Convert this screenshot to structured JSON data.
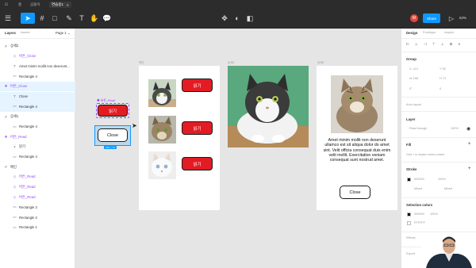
{
  "os_tabs": [
    {
      "label": "홈",
      "active": false
    },
    {
      "label": "곰돌이",
      "active": false
    },
    {
      "label": "연습용1",
      "active": true
    }
  ],
  "toolbar": {
    "share_label": "Share",
    "zoom": "63%",
    "user_initial": "M"
  },
  "layers_panel": {
    "tab_layers": "Layers",
    "tab_assets": "Assets",
    "page": "Page 1",
    "rows": [
      {
        "label": "상세2",
        "indent": 0,
        "kind": "frame"
      },
      {
        "label": "버튼_Close",
        "indent": 1,
        "kind": "instance"
      },
      {
        "label": "Amet minim mollit non deserunt...",
        "indent": 1,
        "kind": "text"
      },
      {
        "label": "Rectangle 4",
        "indent": 1,
        "kind": "rect"
      },
      {
        "label": "버튼_Close",
        "indent": 0,
        "kind": "component",
        "selected": true
      },
      {
        "label": "Close",
        "indent": 1,
        "kind": "text",
        "selected": true
      },
      {
        "label": "Rectangle 4",
        "indent": 1,
        "kind": "rect",
        "selected": true
      },
      {
        "label": "상세1",
        "indent": 0,
        "kind": "frame"
      },
      {
        "label": "Rectangle 4",
        "indent": 1,
        "kind": "rect"
      },
      {
        "label": "버튼_Read",
        "indent": 0,
        "kind": "component"
      },
      {
        "label": "읽기",
        "indent": 1,
        "kind": "text"
      },
      {
        "label": "Rectangle 4",
        "indent": 1,
        "kind": "rect"
      },
      {
        "label": "메인",
        "indent": 0,
        "kind": "frame"
      },
      {
        "label": "버튼_Read",
        "indent": 1,
        "kind": "instance"
      },
      {
        "label": "버튼_Read",
        "indent": 1,
        "kind": "instance"
      },
      {
        "label": "버튼_Read",
        "indent": 1,
        "kind": "instance"
      },
      {
        "label": "Rectangle 3",
        "indent": 1,
        "kind": "rect"
      },
      {
        "label": "Rectangle 2",
        "indent": 1,
        "kind": "rect"
      },
      {
        "label": "Rectangle 1",
        "indent": 1,
        "kind": "rect"
      }
    ]
  },
  "canvas": {
    "component_read_label": "버튼_Read",
    "read_label": "읽기",
    "close_label": "Close",
    "selection_size": "158 × 73",
    "frame_main_label": "메인",
    "frame_detail1_label": "상세1",
    "frame_detail2_label": "상세2",
    "detail_text": "Amet minim mollit non deserunt ullamco est sit aliqua dolor do amet sint. Velit officia consequat duis enim velit mollit. Exercitation veniam consequat sunt nostrud amet."
  },
  "design_panel": {
    "tab_design": "Design",
    "tab_prototype": "Prototype",
    "tab_inspect": "Inspect",
    "section_group": "Group",
    "x": "X  -121",
    "y": "Y  95",
    "w": "W  158",
    "h": "H  73",
    "rotation": "0°",
    "radius": "0",
    "auto_layout": "Auto layout",
    "layer_title": "Layer",
    "blend_mode": "Pass through",
    "layer_opacity": "100%",
    "fill_title": "Fill",
    "fill_hint": "Click + to replace mixed content",
    "stroke_title": "Stroke",
    "stroke_hex": "000000",
    "stroke_opacity": "100%",
    "stroke_position": "Mixed",
    "stroke_weight": "Mixed",
    "selection_colors_title": "Selection colors",
    "selection_colors": [
      {
        "hex": "000000",
        "opacity": "100%",
        "color": "#000000"
      },
      {
        "hex": "FFFFFF",
        "opacity": "",
        "color": "#ffffff"
      }
    ],
    "effects_title": "Effects",
    "export_title": "Export"
  },
  "colors": {
    "accent": "#0d99ff",
    "button_red": "#e31b23",
    "component_purple": "#9747ff"
  }
}
